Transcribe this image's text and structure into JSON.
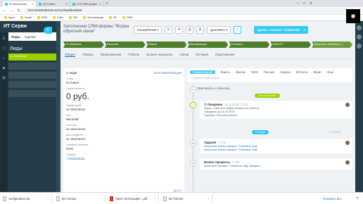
{
  "browser": {
    "tabs": [
      {
        "label": "24 Заполнение CRM-формы \"Фор",
        "active": true
      },
      {
        "label": "(37) Связи",
        "active": false
      },
      {
        "label": "(17) CRM-формы",
        "active": false
      }
    ],
    "new_tab": "+",
    "url": "b24-sze299.bitrix24.ru/crm/lead/details/5/",
    "bookmarks": [
      "Apps",
      "Gmail",
      "SNM",
      "Сайт",
      "320",
      "Организация",
      "ЛК",
      "CRM"
    ],
    "win_controls": [
      "–",
      "□",
      "✕"
    ]
  },
  "bg_app": {
    "brand": "ИТ Серви",
    "tabs": [
      "Лиды",
      "Сделки"
    ],
    "title": "Лиды",
    "rows": [
      "не обработан",
      "",
      "",
      "",
      ""
    ]
  },
  "panel": {
    "title": "Заполнение CRM-формы \"Форма обратной связи\"",
    "extend_label": "РАСШИРЕНИЕ ▾",
    "document_label": "ДОКУМЕНТ ▾",
    "lead_button": "СДЕЛКА + КОНТАКТ + КОМПАНИЯ",
    "stages": [
      "Не обработан",
      "Рассылка",
      "Обзвон",
      "Квалификация",
      "Отложено",
      "ИМПОРТ",
      "Завершить обработку л..."
    ],
    "tabs": [
      "Общее",
      "Товары",
      "Предложения",
      "Роботы",
      "Бизнес-процессы",
      "Связи",
      "История",
      "Приложения"
    ]
  },
  "lead_info": {
    "header": "О ЛИДЕ",
    "header_link": "ВСЯ ИНФОРМАЦИЯ",
    "fields": [
      {
        "label": "Статус",
        "value": "Отложен",
        "style": ""
      },
      {
        "label": "Сумма и валюта",
        "value": "0 руб.",
        "style": "big"
      },
      {
        "label": "Комментарий",
        "value": "не заполнено",
        "style": ""
      },
      {
        "label": "Имя",
        "value": "Василий",
        "style": ""
      },
      {
        "label": "Отчество",
        "value": "не заполнено",
        "style": ""
      },
      {
        "label": "Дата рождения",
        "value": "не заполнено",
        "style": ""
      },
      {
        "label": "Название компании",
        "value": "ООО",
        "style": ""
      },
      {
        "label": "Телефон",
        "value": "+72111111111",
        "style": "link"
      }
    ],
    "bottom": "Другой"
  },
  "activity": {
    "tabs": [
      "Комментарий",
      "Ждать",
      "Звонок",
      "SMS",
      "Письмо",
      "Задача",
      "Встреча",
      "Визит",
      "Еще"
    ],
    "placeholder": "Оставьте комментарий",
    "pin_label": "Пригласить к событию...",
    "scheduled_badge": "Запланировано",
    "today_badge": "Сегодня",
    "filter_label": "▼ ФИЛЬТР",
    "waiting": {
      "title": "Ожидание",
      "time": "26 октября 17:55",
      "lines": [
        "Ждать 4 дня или любую активность клиента",
        "Ожидание до 16.10.2020",
        "Причина: Просьба клиента"
      ]
    },
    "task": {
      "title": "Задание",
      "time": "17:55",
      "lines": [
        "Запустили бизнес-процесс \"Отменить Лид\"",
        "Запустили бизнес-процесс \"Отменить Лид\""
      ]
    },
    "bp": {
      "title": "Бизнес-процессы",
      "time": "17:55",
      "lines": [
        "Запустили Процесс \"Отменить Лид\" запущен"
      ]
    }
  },
  "downloads": [
    {
      "name": "configuration.zip",
      "pdf": false
    },
    {
      "name": "bp-719.bpt",
      "pdf": false
    },
    {
      "name": "Пакет интеграции-...pdf",
      "pdf": true
    },
    {
      "name": "bp-705.bpt",
      "pdf": false
    }
  ],
  "downloads_show_all": "Показать все",
  "downloads_close": "✕"
}
